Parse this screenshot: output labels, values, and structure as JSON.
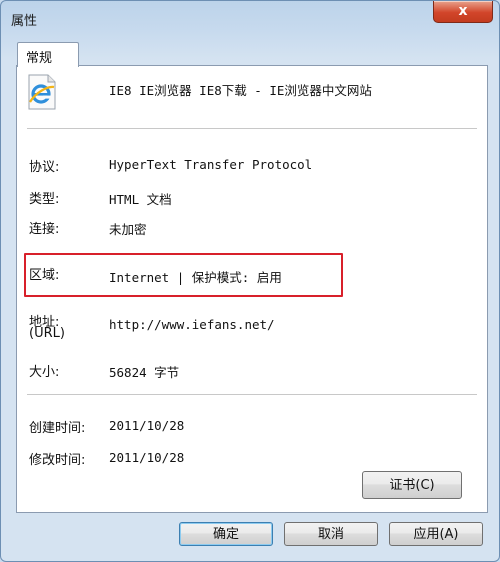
{
  "window": {
    "title": "属性",
    "close_label": "x"
  },
  "tab": {
    "label": "常规"
  },
  "page": {
    "title": "IE8 IE浏览器 IE8下载 - IE浏览器中文网站"
  },
  "props": {
    "protocol": {
      "label": "协议:",
      "value": "HyperText Transfer Protocol"
    },
    "type": {
      "label": "类型:",
      "value": "HTML 文档"
    },
    "connection": {
      "label": "连接:",
      "value": "未加密"
    },
    "zone": {
      "label": "区域:",
      "value": "Internet | 保护模式: 启用"
    },
    "address": {
      "label": "地址:",
      "sublabel": "(URL)",
      "value": "http://www.iefans.net/"
    },
    "size": {
      "label": "大小:",
      "value": "56824 字节"
    },
    "created": {
      "label": "创建时间:",
      "value": "2011/10/28"
    },
    "modified": {
      "label": "修改时间:",
      "value": "2011/10/28"
    }
  },
  "buttons": {
    "certificate": "证书(C)",
    "ok": "确定",
    "cancel": "取消",
    "apply": "应用(A)"
  },
  "icons": {
    "page": "ie-page-icon",
    "close": "close-icon"
  },
  "colors": {
    "highlight": "#d8202a",
    "close": "#d2452a"
  }
}
